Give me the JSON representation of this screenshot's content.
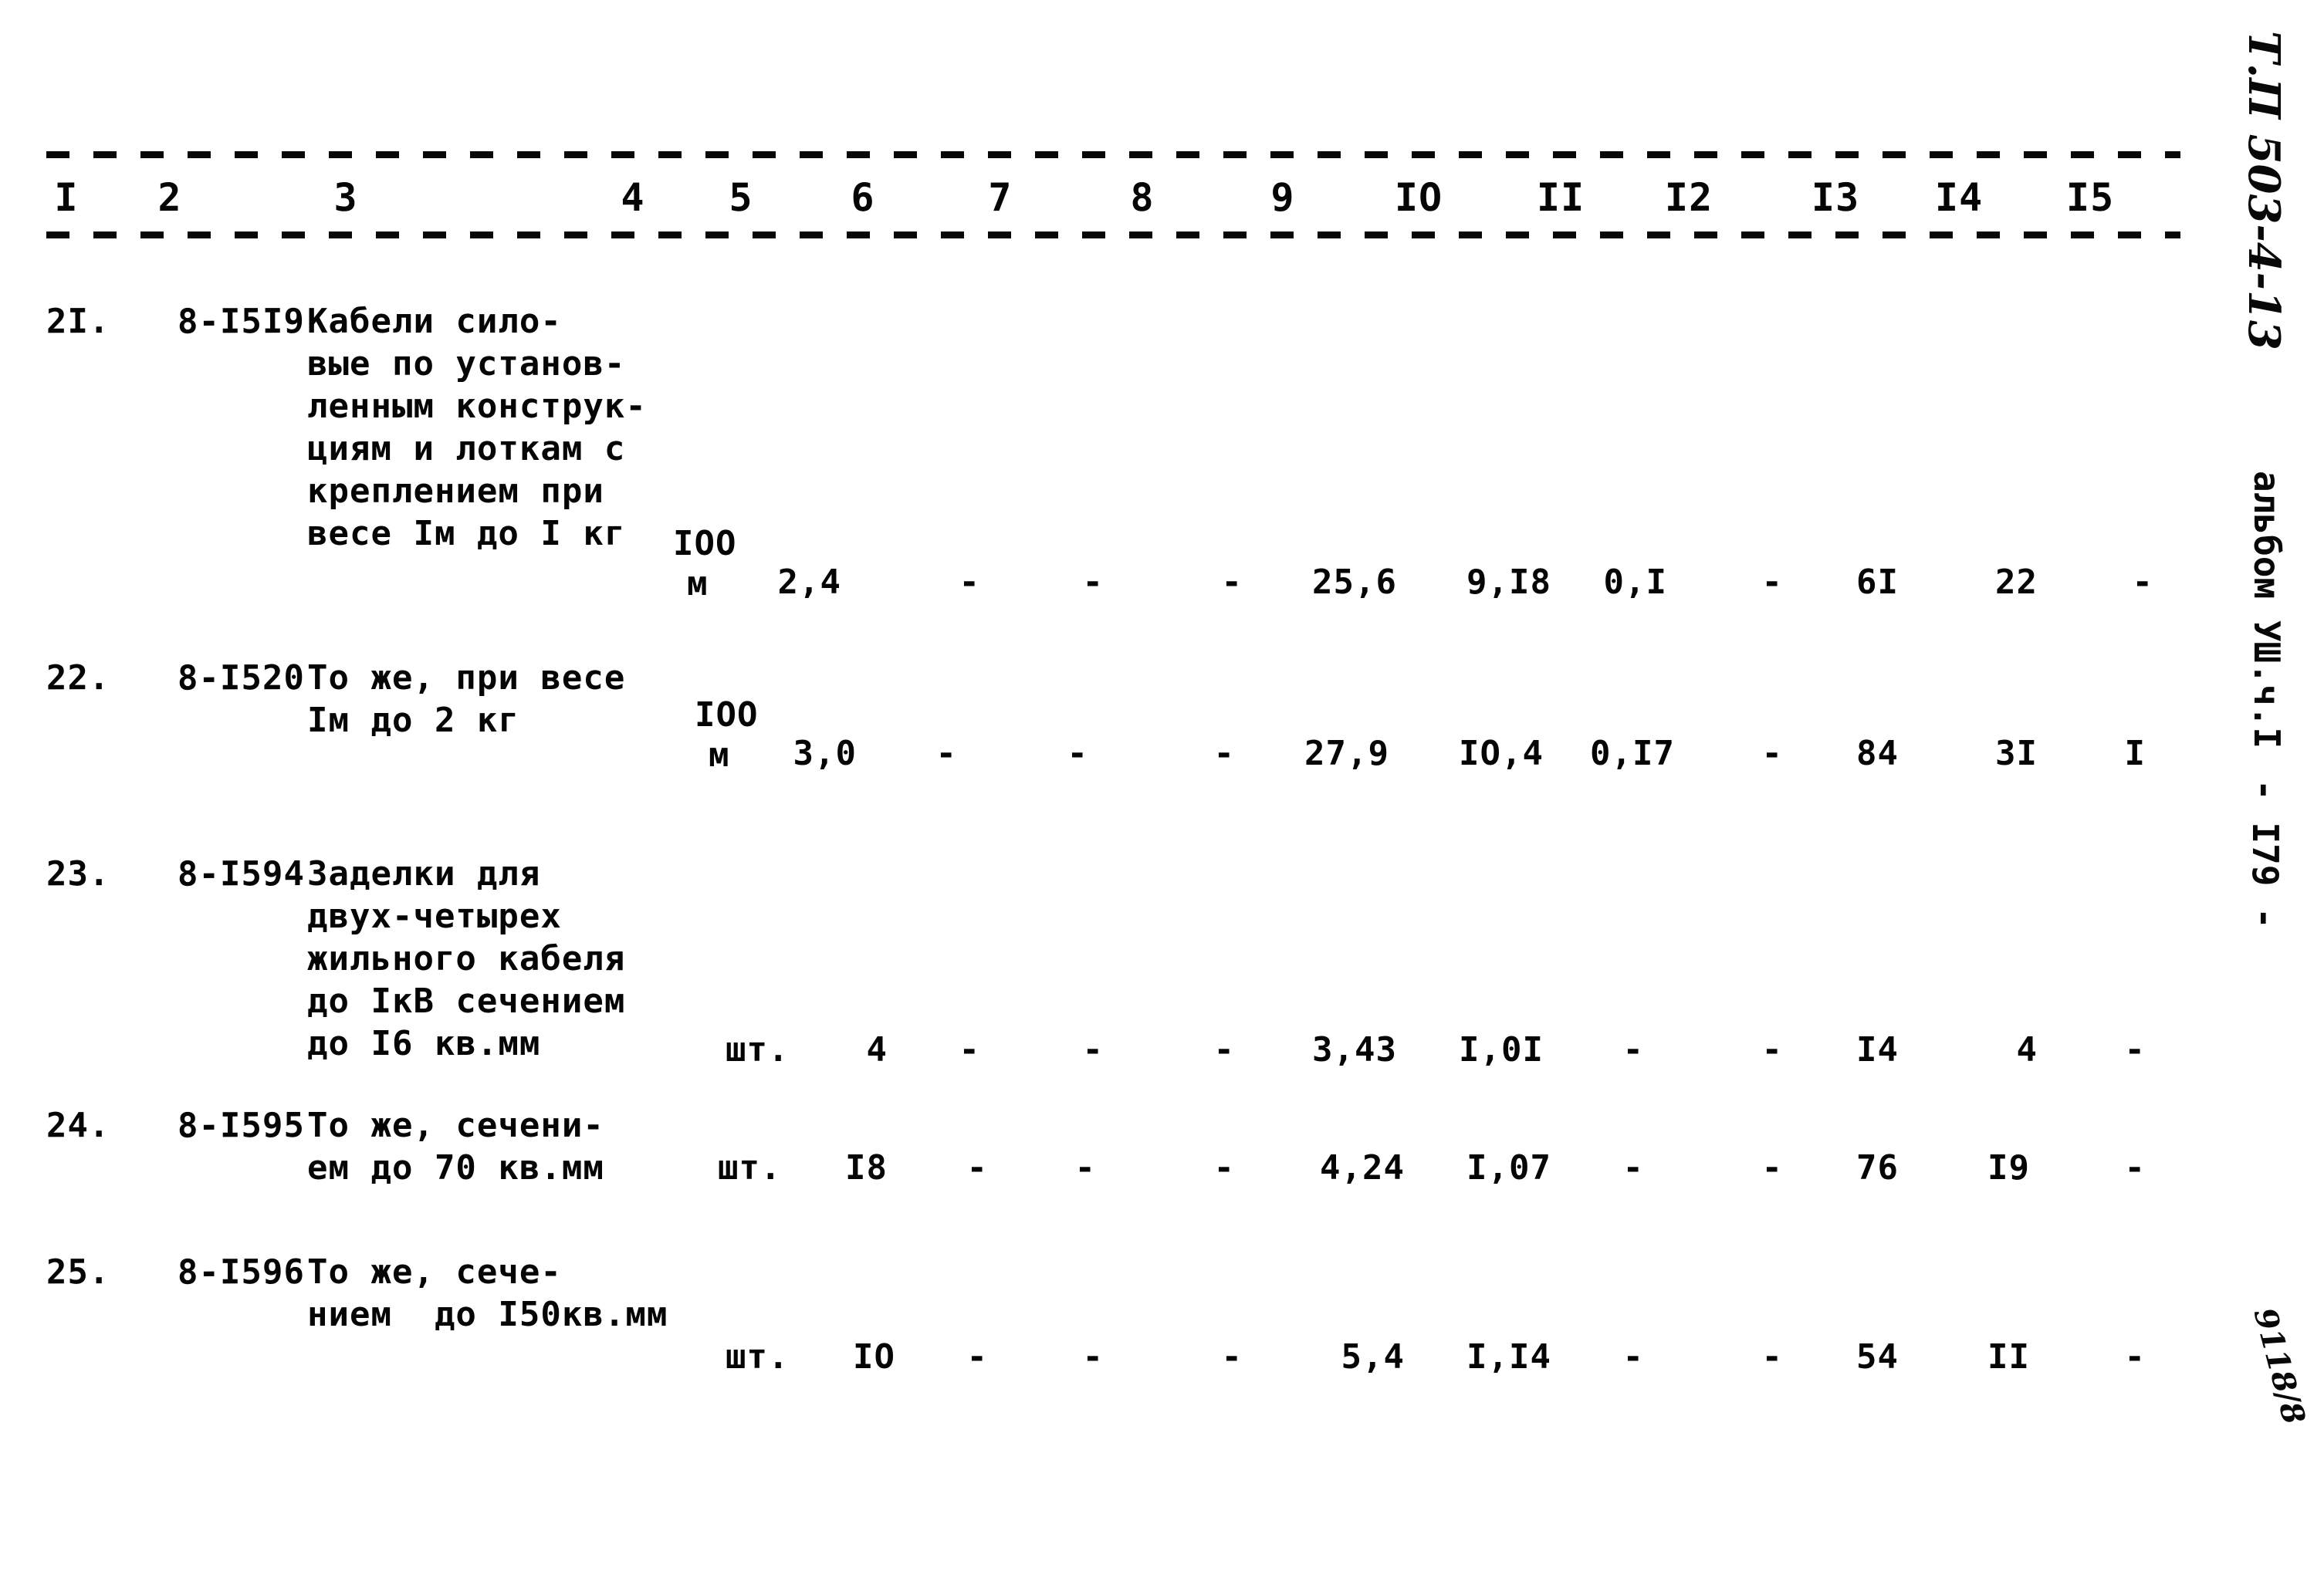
{
  "document": {
    "type": "scanned-estimate-table",
    "background_color": "#ffffff",
    "ink_color": "#070707"
  },
  "table": {
    "column_numbers": [
      "I",
      "2",
      "3",
      "4",
      "5",
      "6",
      "7",
      "8",
      "9",
      "IO",
      "II",
      "I2",
      "I3",
      "I4",
      "I5"
    ],
    "rows": [
      {
        "no": "2I.",
        "code": "8-I5I9",
        "description": [
          "Кабели сило-",
          "вые по установ-",
          "ленным конструк-",
          "циям и лоткам с",
          "креплением при",
          "весе Iм до I кг"
        ],
        "unit": [
          "IOO",
          "м"
        ],
        "values": [
          "2,4",
          "-",
          "-",
          "-",
          "25,6",
          "9,I8",
          "0,I",
          "-",
          "6I",
          "22",
          "-"
        ]
      },
      {
        "no": "22.",
        "code": "8-I520",
        "description": [
          "То же, при весе",
          "Iм до 2 кг"
        ],
        "unit": [
          "IOO",
          "м"
        ],
        "values": [
          "3,0",
          "-",
          "-",
          "-",
          "27,9",
          "IO,4",
          "0,I7",
          "-",
          "84",
          "3I",
          "I"
        ]
      },
      {
        "no": "23.",
        "code": "8-I594",
        "description": [
          "Заделки для",
          "двух-четырех",
          "жильного кабеля",
          "до IкВ сечением",
          "до I6 кв.мм"
        ],
        "unit": [
          "шт."
        ],
        "values": [
          "4",
          "-",
          "-",
          "-",
          "3,43",
          "I,0I",
          "-",
          "-",
          "I4",
          "4",
          "-"
        ]
      },
      {
        "no": "24.",
        "code": "8-I595",
        "description": [
          "То же, сечени-",
          "ем до 70 кв.мм"
        ],
        "unit": [
          "шт."
        ],
        "values": [
          "I8",
          "-",
          "-",
          "-",
          "4,24",
          "I,07",
          "-",
          "-",
          "76",
          "I9",
          "-"
        ]
      },
      {
        "no": "25.",
        "code": "8-I596",
        "description": [
          "То же, сече-",
          "нием  до I50кв.мм"
        ],
        "unit": [
          "шт."
        ],
        "values": [
          "IO",
          "-",
          "-",
          "-",
          "5,4",
          "I,I4",
          "-",
          "-",
          "54",
          "II",
          "-"
        ]
      }
    ]
  },
  "margin": {
    "project_code": "Т.П 503-4-13",
    "album": "альбом УШ.ч.I",
    "page": "- I79 -",
    "stamp": "9118/8"
  }
}
